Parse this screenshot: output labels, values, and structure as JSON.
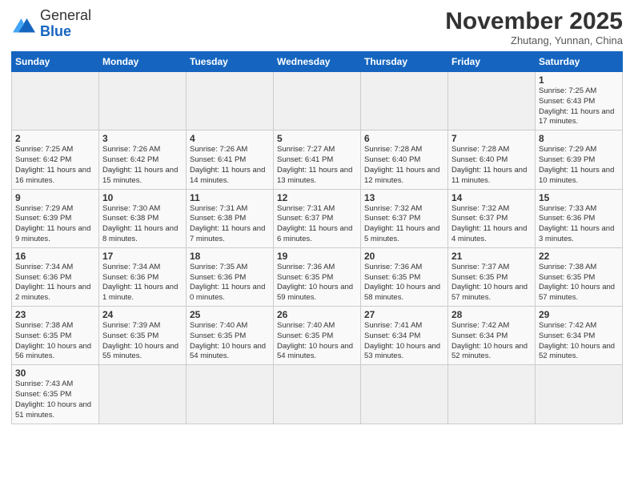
{
  "logo": {
    "general": "General",
    "blue": "Blue"
  },
  "header": {
    "month": "November 2025",
    "location": "Zhutang, Yunnan, China"
  },
  "weekdays": [
    "Sunday",
    "Monday",
    "Tuesday",
    "Wednesday",
    "Thursday",
    "Friday",
    "Saturday"
  ],
  "days": [
    {
      "date": "",
      "info": ""
    },
    {
      "date": "",
      "info": ""
    },
    {
      "date": "",
      "info": ""
    },
    {
      "date": "",
      "info": ""
    },
    {
      "date": "",
      "info": ""
    },
    {
      "date": "",
      "info": ""
    },
    {
      "date": "1",
      "info": "Sunrise: 7:25 AM\nSunset: 6:43 PM\nDaylight: 11 hours and 17 minutes."
    },
    {
      "date": "2",
      "info": "Sunrise: 7:25 AM\nSunset: 6:42 PM\nDaylight: 11 hours and 16 minutes."
    },
    {
      "date": "3",
      "info": "Sunrise: 7:26 AM\nSunset: 6:42 PM\nDaylight: 11 hours and 15 minutes."
    },
    {
      "date": "4",
      "info": "Sunrise: 7:26 AM\nSunset: 6:41 PM\nDaylight: 11 hours and 14 minutes."
    },
    {
      "date": "5",
      "info": "Sunrise: 7:27 AM\nSunset: 6:41 PM\nDaylight: 11 hours and 13 minutes."
    },
    {
      "date": "6",
      "info": "Sunrise: 7:28 AM\nSunset: 6:40 PM\nDaylight: 11 hours and 12 minutes."
    },
    {
      "date": "7",
      "info": "Sunrise: 7:28 AM\nSunset: 6:40 PM\nDaylight: 11 hours and 11 minutes."
    },
    {
      "date": "8",
      "info": "Sunrise: 7:29 AM\nSunset: 6:39 PM\nDaylight: 11 hours and 10 minutes."
    },
    {
      "date": "9",
      "info": "Sunrise: 7:29 AM\nSunset: 6:39 PM\nDaylight: 11 hours and 9 minutes."
    },
    {
      "date": "10",
      "info": "Sunrise: 7:30 AM\nSunset: 6:38 PM\nDaylight: 11 hours and 8 minutes."
    },
    {
      "date": "11",
      "info": "Sunrise: 7:31 AM\nSunset: 6:38 PM\nDaylight: 11 hours and 7 minutes."
    },
    {
      "date": "12",
      "info": "Sunrise: 7:31 AM\nSunset: 6:37 PM\nDaylight: 11 hours and 6 minutes."
    },
    {
      "date": "13",
      "info": "Sunrise: 7:32 AM\nSunset: 6:37 PM\nDaylight: 11 hours and 5 minutes."
    },
    {
      "date": "14",
      "info": "Sunrise: 7:32 AM\nSunset: 6:37 PM\nDaylight: 11 hours and 4 minutes."
    },
    {
      "date": "15",
      "info": "Sunrise: 7:33 AM\nSunset: 6:36 PM\nDaylight: 11 hours and 3 minutes."
    },
    {
      "date": "16",
      "info": "Sunrise: 7:34 AM\nSunset: 6:36 PM\nDaylight: 11 hours and 2 minutes."
    },
    {
      "date": "17",
      "info": "Sunrise: 7:34 AM\nSunset: 6:36 PM\nDaylight: 11 hours and 1 minute."
    },
    {
      "date": "18",
      "info": "Sunrise: 7:35 AM\nSunset: 6:36 PM\nDaylight: 11 hours and 0 minutes."
    },
    {
      "date": "19",
      "info": "Sunrise: 7:36 AM\nSunset: 6:35 PM\nDaylight: 10 hours and 59 minutes."
    },
    {
      "date": "20",
      "info": "Sunrise: 7:36 AM\nSunset: 6:35 PM\nDaylight: 10 hours and 58 minutes."
    },
    {
      "date": "21",
      "info": "Sunrise: 7:37 AM\nSunset: 6:35 PM\nDaylight: 10 hours and 57 minutes."
    },
    {
      "date": "22",
      "info": "Sunrise: 7:38 AM\nSunset: 6:35 PM\nDaylight: 10 hours and 57 minutes."
    },
    {
      "date": "23",
      "info": "Sunrise: 7:38 AM\nSunset: 6:35 PM\nDaylight: 10 hours and 56 minutes."
    },
    {
      "date": "24",
      "info": "Sunrise: 7:39 AM\nSunset: 6:35 PM\nDaylight: 10 hours and 55 minutes."
    },
    {
      "date": "25",
      "info": "Sunrise: 7:40 AM\nSunset: 6:35 PM\nDaylight: 10 hours and 54 minutes."
    },
    {
      "date": "26",
      "info": "Sunrise: 7:40 AM\nSunset: 6:35 PM\nDaylight: 10 hours and 54 minutes."
    },
    {
      "date": "27",
      "info": "Sunrise: 7:41 AM\nSunset: 6:34 PM\nDaylight: 10 hours and 53 minutes."
    },
    {
      "date": "28",
      "info": "Sunrise: 7:42 AM\nSunset: 6:34 PM\nDaylight: 10 hours and 52 minutes."
    },
    {
      "date": "29",
      "info": "Sunrise: 7:42 AM\nSunset: 6:34 PM\nDaylight: 10 hours and 52 minutes."
    },
    {
      "date": "30",
      "info": "Sunrise: 7:43 AM\nSunset: 6:35 PM\nDaylight: 10 hours and 51 minutes."
    },
    {
      "date": "",
      "info": ""
    },
    {
      "date": "",
      "info": ""
    },
    {
      "date": "",
      "info": ""
    },
    {
      "date": "",
      "info": ""
    },
    {
      "date": "",
      "info": ""
    },
    {
      "date": "",
      "info": ""
    }
  ]
}
